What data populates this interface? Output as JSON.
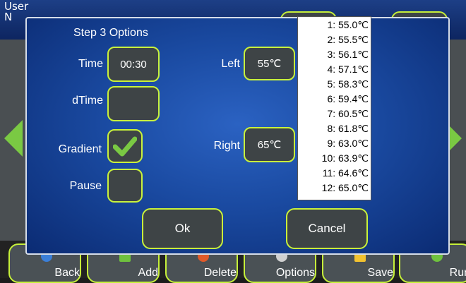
{
  "background": {
    "user_label_line1": "User",
    "user_label_line2": "N",
    "bottom_buttons": [
      {
        "label": "Back",
        "icon": "globe-icon"
      },
      {
        "label": "Add",
        "icon": "plus-icon"
      },
      {
        "label": "Delete",
        "icon": "delete-icon"
      },
      {
        "label": "Options",
        "icon": "gear-icon"
      },
      {
        "label": "Save",
        "icon": "save-icon"
      },
      {
        "label": "Run",
        "icon": "play-icon"
      }
    ]
  },
  "dialog": {
    "title": "Step 3 Options",
    "time_label": "Time",
    "time_value": "00:30",
    "dtime_label": "dTime",
    "dtime_value": "",
    "gradient_label": "Gradient",
    "gradient_checked": true,
    "pause_label": "Pause",
    "pause_checked": false,
    "left_label": "Left",
    "left_value": "55℃",
    "right_label": "Right",
    "right_value": "65℃",
    "ok_label": "Ok",
    "cancel_label": "Cancel"
  },
  "gradient_list": [
    "1: 55.0℃",
    "2: 55.5℃",
    "3: 56.1℃",
    "4: 57.1℃",
    "5: 58.3℃",
    "6: 59.4℃",
    "7: 60.5℃",
    "8: 61.8℃",
    "9: 63.0℃",
    "10: 63.9℃",
    "11: 64.6℃",
    "12: 65.0℃"
  ],
  "colors": {
    "accent": "#c9f23b",
    "dialog_bg": "#1a4aa1",
    "check": "#7ac943"
  }
}
